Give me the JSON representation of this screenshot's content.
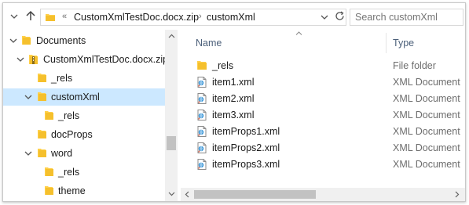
{
  "toolbar": {
    "back_icon": "chevron-down-icon",
    "up_icon": "up-arrow-icon"
  },
  "address": {
    "overflow": "«",
    "segments": [
      "CustomXmlTestDoc.docx.zip",
      "customXml"
    ],
    "separator": "›"
  },
  "search": {
    "placeholder": "Search customXml"
  },
  "tree": [
    {
      "label": "Documents",
      "expanded": true,
      "level": 0
    },
    {
      "label": "CustomXmlTestDoc.docx.zip",
      "expanded": true,
      "level": 1,
      "zip": true
    },
    {
      "label": "_rels",
      "level": 2
    },
    {
      "label": "customXml",
      "expanded": true,
      "level": 2,
      "selected": true
    },
    {
      "label": "_rels",
      "level": 3
    },
    {
      "label": "docProps",
      "level": 2
    },
    {
      "label": "word",
      "expanded": true,
      "level": 2
    },
    {
      "label": "_rels",
      "level": 3
    },
    {
      "label": "theme",
      "level": 3
    }
  ],
  "columns": {
    "name": "Name",
    "type": "Type"
  },
  "files": [
    {
      "name": "_rels",
      "type": "File folder",
      "icon": "folder-icon"
    },
    {
      "name": "item1.xml",
      "type": "XML Document",
      "icon": "xml-document-icon"
    },
    {
      "name": "item2.xml",
      "type": "XML Document",
      "icon": "xml-document-icon"
    },
    {
      "name": "item3.xml",
      "type": "XML Document",
      "icon": "xml-document-icon"
    },
    {
      "name": "itemProps1.xml",
      "type": "XML Document",
      "icon": "xml-document-icon"
    },
    {
      "name": "itemProps2.xml",
      "type": "XML Document",
      "icon": "xml-document-icon"
    },
    {
      "name": "itemProps3.xml",
      "type": "XML Document",
      "icon": "xml-document-icon"
    }
  ],
  "colors": {
    "selection": "#cce8ff",
    "folder": "#ffd04a",
    "header_text": "#4c607a"
  }
}
